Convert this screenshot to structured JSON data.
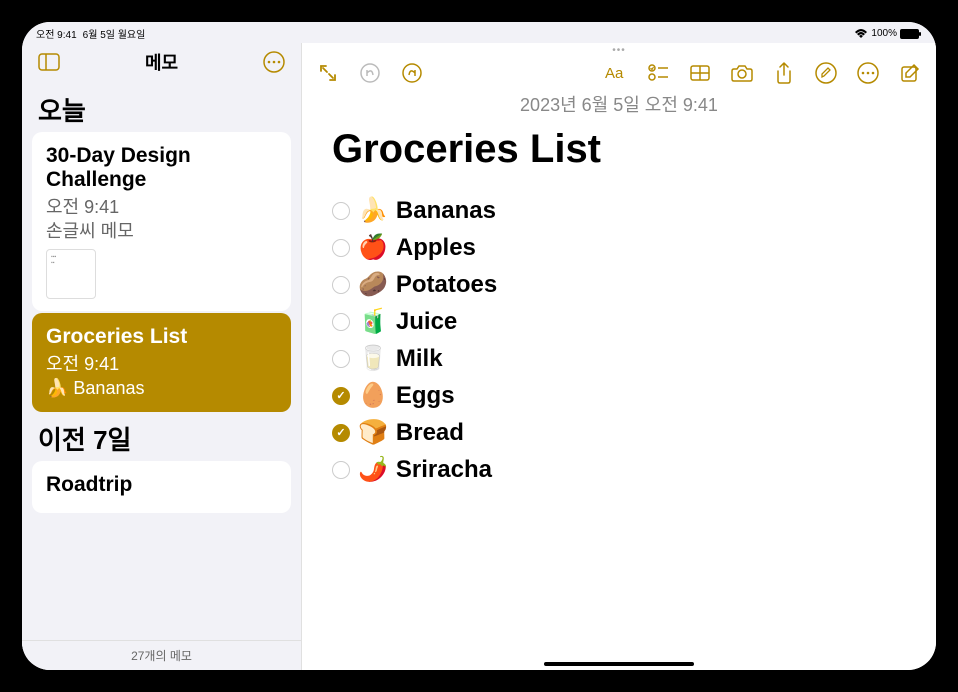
{
  "status": {
    "time": "오전 9:41",
    "date": "6월 5일 월요일",
    "battery": "100%"
  },
  "sidebar": {
    "title": "메모",
    "sections": [
      {
        "header": "오늘",
        "notes": [
          {
            "title": "30-Day Design Challenge",
            "time": "오전 9:41",
            "preview": "손글씨 메모",
            "selected": false,
            "has_thumb": true
          },
          {
            "title": "Groceries List",
            "time": "오전 9:41",
            "preview": "🍌 Bananas",
            "selected": true,
            "has_thumb": false
          }
        ]
      },
      {
        "header": "이전 7일",
        "notes": [
          {
            "title": "Roadtrip",
            "time": "",
            "preview": "",
            "selected": false,
            "has_thumb": false
          }
        ]
      }
    ],
    "footer": "27개의 메모"
  },
  "note": {
    "date_header": "2023년 6월 5일 오전 9:41",
    "title": "Groceries List",
    "items": [
      {
        "emoji": "🍌",
        "text": "Bananas",
        "checked": false
      },
      {
        "emoji": "🍎",
        "text": "Apples",
        "checked": false
      },
      {
        "emoji": "🥔",
        "text": "Potatoes",
        "checked": false
      },
      {
        "emoji": "🧃",
        "text": "Juice",
        "checked": false
      },
      {
        "emoji": "🥛",
        "text": "Milk",
        "checked": false
      },
      {
        "emoji": "🥚",
        "text": "Eggs",
        "checked": true
      },
      {
        "emoji": "🍞",
        "text": "Bread",
        "checked": true
      },
      {
        "emoji": "🌶️",
        "text": "Sriracha",
        "checked": false
      }
    ]
  },
  "colors": {
    "accent": "#b58a00"
  }
}
